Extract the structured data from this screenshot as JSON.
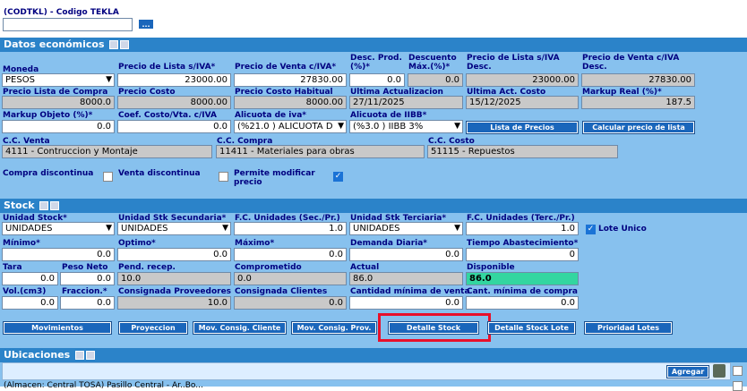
{
  "codtkl": {
    "label": "(CODTKL) - Codigo TEKLA",
    "value": "",
    "lookup_button": "..."
  },
  "datos": {
    "title": "Datos económicos",
    "moneda_label": "Moneda",
    "moneda_value": "PESOS",
    "precio_lista_siva_label": "Precio de Lista s/IVA*",
    "precio_lista_siva": "23000.00",
    "precio_venta_civa_label": "Precio de Venta c/IVA*",
    "precio_venta_civa": "27830.00",
    "desc_prod_label": "Desc. Prod. (%)*",
    "desc_prod": "0.0",
    "descuento_max_label": "Descuento Máx.(%)*",
    "descuento_max": "0.0",
    "precio_lista_siva_desc_label": "Precio de Lista s/IVA Desc.",
    "precio_lista_siva_desc": "23000.00",
    "precio_venta_civa_desc_label": "Precio de Venta c/IVA Desc.",
    "precio_venta_civa_desc": "27830.00",
    "precio_lista_compra_label": "Precio Lista de Compra",
    "precio_lista_compra": "8000.0",
    "precio_costo_label": "Precio Costo",
    "precio_costo": "8000.00",
    "precio_costo_habitual_label": "Precio Costo Habitual",
    "precio_costo_habitual": "8000.00",
    "ultima_actualizacion_label": "Ultima Actualizacion",
    "ultima_actualizacion": "27/11/2025",
    "ultima_act_costo_label": "Ultima Act. Costo",
    "ultima_act_costo": "15/12/2025",
    "markup_real_label": "Markup Real (%)*",
    "markup_real": "187.5",
    "markup_objeto_label": "Markup Objeto (%)*",
    "markup_objeto": "0.0",
    "coef_costo_label": "Coef. Costo/Vta. c/IVA",
    "coef_costo": "0.0",
    "alicuota_iva_label": "Alicuota de iva*",
    "alicuota_iva": "(%21.0 ) ALICUOTA D",
    "alicuota_iibb_label": "Alicuota de IIBB*",
    "alicuota_iibb": "(%3.0 ) IIBB 3%",
    "lista_precios_button": "Lista de Precios",
    "calcular_precio_button": "Calcular precio de lista",
    "cc_venta_label": "C.C. Venta",
    "cc_venta": "4111 - Contruccion y Montaje",
    "cc_compra_label": "C.C. Compra",
    "cc_compra": "11411 - Materiales para obras",
    "cc_costo_label": "C.C. Costo",
    "cc_costo": "51115 - Repuestos",
    "compra_discontinua_label": "Compra discontinua",
    "venta_discontinua_label": "Venta discontinua",
    "permite_modificar_label": "Permite modificar precio"
  },
  "stock": {
    "title": "Stock",
    "unidad_stock_label": "Unidad Stock*",
    "unidad_stock": "UNIDADES",
    "unidad_secundaria_label": "Unidad Stk Secundaria*",
    "unidad_secundaria": "UNIDADES",
    "fc_sec_label": "F.C. Unidades (Sec./Pr.)",
    "fc_sec": "1.0",
    "unidad_terciaria_label": "Unidad Stk Terciaria*",
    "unidad_terciaria": "UNIDADES",
    "fc_terc_label": "F.C. Unidades (Terc./Pr.)",
    "fc_terc": "1.0",
    "lote_unico_label": "Lote Unico",
    "minimo_label": "Mínimo*",
    "minimo": "0.0",
    "optimo_label": "Optimo*",
    "optimo": "0.0",
    "maximo_label": "Máximo*",
    "maximo": "0.0",
    "demanda_label": "Demanda Diaria*",
    "demanda": "0.0",
    "tiempo_label": "Tiempo Abastecimiento*",
    "tiempo": "0",
    "tara_label": "Tara",
    "tara": "0.0",
    "peso_label": "Peso Neto",
    "peso": "0.0",
    "pend_label": "Pend. recep.",
    "pend": "10.0",
    "comprometido_label": "Comprometido",
    "comprometido": "0.0",
    "actual_label": "Actual",
    "actual": "86.0",
    "disponible_label": "Disponible",
    "disponible": "86.0",
    "vol_label": "Vol.(cm3)",
    "vol": "0.0",
    "fraccion_label": "Fraccion.*",
    "fraccion": "0.0",
    "consig_prov_label": "Consignada Proveedores",
    "consig_prov": "10.0",
    "consig_cli_label": "Consignada Clientes",
    "consig_cli": "0.0",
    "cant_min_venta_label": "Cantidad mínima de venta",
    "cant_min_venta": "0.0",
    "cant_min_compra_label": "Cant. mínima de compra",
    "cant_min_compra": "0.0",
    "buttons": [
      "Movimientos",
      "Proyeccion",
      "Mov. Consig. Cliente",
      "Mov. Consig. Prov.",
      "Detalle Stock",
      "Detalle Stock Lote",
      "Prioridad Lotes"
    ]
  },
  "ubicaciones": {
    "title": "Ubicaciones",
    "agregar_button": "Agregar",
    "first_row": "(Almacen: Central TOSA) Pasillo Central - Ar..Bo..."
  },
  "colors": {
    "section_bar": "#2b83c9",
    "panel": "#87c1ee",
    "button": "#1a66bb",
    "highlight": "#e8102a"
  }
}
